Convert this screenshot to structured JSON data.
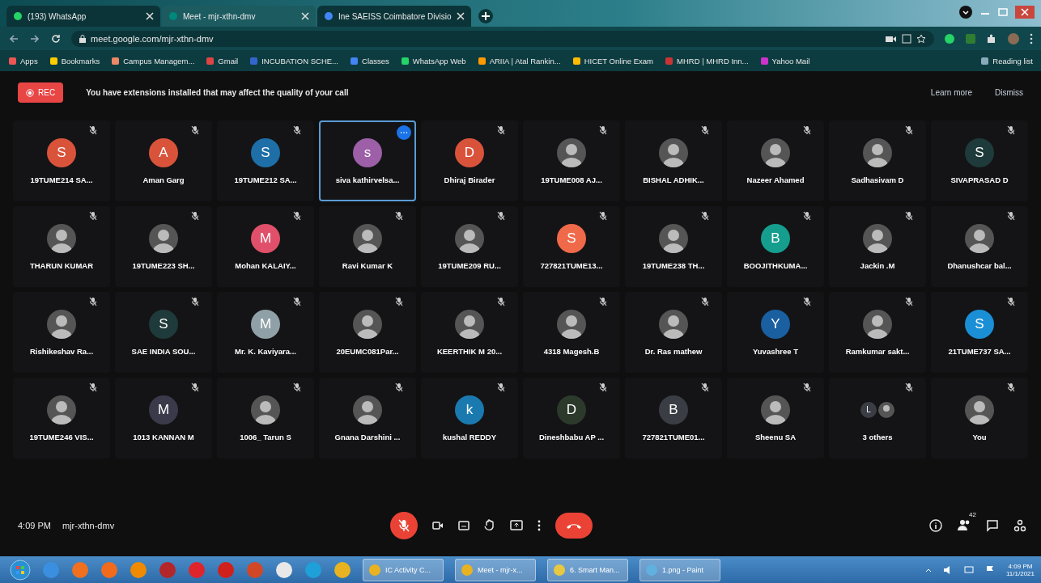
{
  "browser": {
    "tabs": [
      {
        "title": "(193) WhatsApp",
        "selected": false
      },
      {
        "title": "Meet - mjr-xthn-dmv",
        "selected": true
      },
      {
        "title": "Ine SAEISS Coimbatore Divisio",
        "selected": false
      }
    ],
    "address": "meet.google.com/mjr-xthn-dmv",
    "bookmarks": [
      "Apps",
      "Bookmarks",
      "Campus Managem...",
      "Gmail",
      "INCUBATION SCHE...",
      "Classes",
      "WhatsApp Web",
      "ARIIA | Atal Rankin...",
      "HICET Online Exam",
      "MHRD | MHRD Inn...",
      "Yahoo Mail"
    ],
    "reading_list": "Reading list"
  },
  "banner": {
    "rec": "REC",
    "message": "You have extensions installed that may affect the quality of your call",
    "links": [
      "Learn more",
      "Dismiss"
    ]
  },
  "tiles": [
    {
      "name": "19TUME214 SA...",
      "kind": "letter",
      "initial": "S",
      "color": "#d9533b",
      "selected": false
    },
    {
      "name": "Aman Garg",
      "kind": "letter",
      "initial": "A",
      "color": "#d9533b",
      "selected": false
    },
    {
      "name": "19TUME212 SA...",
      "kind": "letter",
      "initial": "S",
      "color": "#1e6fa8",
      "selected": false
    },
    {
      "name": "siva kathirvelsa...",
      "kind": "letter",
      "initial": "s",
      "color": "#9c5fa8",
      "selected": true
    },
    {
      "name": "Dhiraj Birader",
      "kind": "letter",
      "initial": "D",
      "color": "#d9533b",
      "selected": false
    },
    {
      "name": "19TUME008 AJ...",
      "kind": "photo",
      "selected": false
    },
    {
      "name": "BISHAL ADHIK...",
      "kind": "photo",
      "selected": false
    },
    {
      "name": "Nazeer Ahamed",
      "kind": "photo",
      "selected": false
    },
    {
      "name": "Sadhasivam D",
      "kind": "photo",
      "selected": false
    },
    {
      "name": "SIVAPRASAD D",
      "kind": "letter",
      "initial": "S",
      "color": "#1f3a3a",
      "selected": false
    },
    {
      "name": "THARUN KUMAR",
      "kind": "photo",
      "selected": false
    },
    {
      "name": "19TUME223 SH...",
      "kind": "photo",
      "selected": false
    },
    {
      "name": "Mohan KALAIY...",
      "kind": "letter",
      "initial": "M",
      "color": "#e0506a",
      "selected": false
    },
    {
      "name": "Ravi Kumar K",
      "kind": "photo",
      "selected": false
    },
    {
      "name": "19TUME209 RU...",
      "kind": "photo",
      "selected": false
    },
    {
      "name": "727821TUME13...",
      "kind": "letter",
      "initial": "S",
      "color": "#f06a4a",
      "selected": false
    },
    {
      "name": "19TUME238 TH...",
      "kind": "photo",
      "selected": false
    },
    {
      "name": "BOOJITHKUMA...",
      "kind": "letter",
      "initial": "B",
      "color": "#159e8e",
      "selected": false
    },
    {
      "name": "Jackin .M",
      "kind": "photo",
      "selected": false
    },
    {
      "name": "Dhanushcar bal...",
      "kind": "photo",
      "selected": false
    },
    {
      "name": "Rishikeshav Ra...",
      "kind": "photo",
      "selected": false
    },
    {
      "name": "SAE INDIA SOU...",
      "kind": "letter",
      "initial": "S",
      "color": "#1f3a3a",
      "selected": false
    },
    {
      "name": "Mr. K. Kaviyara...",
      "kind": "letter",
      "initial": "M",
      "color": "#8fa0a6",
      "selected": false
    },
    {
      "name": "20EUMC081Par...",
      "kind": "photo",
      "selected": false
    },
    {
      "name": "KEERTHIK M 20...",
      "kind": "photo",
      "selected": false
    },
    {
      "name": "4318 Magesh.B",
      "kind": "photo",
      "selected": false
    },
    {
      "name": "Dr. Ras mathew",
      "kind": "photo",
      "selected": false
    },
    {
      "name": "Yuvashree T",
      "kind": "letter",
      "initial": "Y",
      "color": "#1a5fa0",
      "selected": false
    },
    {
      "name": "Ramkumar sakt...",
      "kind": "photo",
      "selected": false
    },
    {
      "name": "21TUME737 SA...",
      "kind": "letter",
      "initial": "S",
      "color": "#1a8fd6",
      "selected": false
    },
    {
      "name": "19TUME246 VIS...",
      "kind": "photo",
      "selected": false
    },
    {
      "name": "1013 KANNAN M",
      "kind": "letter",
      "initial": "M",
      "color": "#3a3a4a",
      "selected": false
    },
    {
      "name": "1006_ Tarun S",
      "kind": "photo",
      "selected": false
    },
    {
      "name": "Gnana Darshini ...",
      "kind": "photo",
      "selected": false
    },
    {
      "name": "kushal REDDY",
      "kind": "letter",
      "initial": "k",
      "color": "#1a7ab0",
      "selected": false
    },
    {
      "name": "Dineshbabu AP ...",
      "kind": "letter",
      "initial": "D",
      "color": "#2c3a2c",
      "selected": false
    },
    {
      "name": "727821TUME01...",
      "kind": "letter",
      "initial": "B",
      "color": "#3a3d44",
      "selected": false
    },
    {
      "name": "Sheenu SA",
      "kind": "photo",
      "selected": false
    },
    {
      "name": "3 others",
      "kind": "others",
      "initial": "L",
      "color": "#3a3d44",
      "selected": false
    },
    {
      "name": "You",
      "kind": "photo",
      "selected": false
    }
  ],
  "call_bar": {
    "time": "4:09 PM",
    "meeting_code": "mjr-xthn-dmv",
    "participant_count": "42"
  },
  "taskbar": {
    "tasks": [
      "IC Activity C...",
      "Meet - mjr-x...",
      "6. Smart Man...",
      "1.png - Paint"
    ],
    "time": "4:09 PM",
    "date": "11/1/2021"
  }
}
